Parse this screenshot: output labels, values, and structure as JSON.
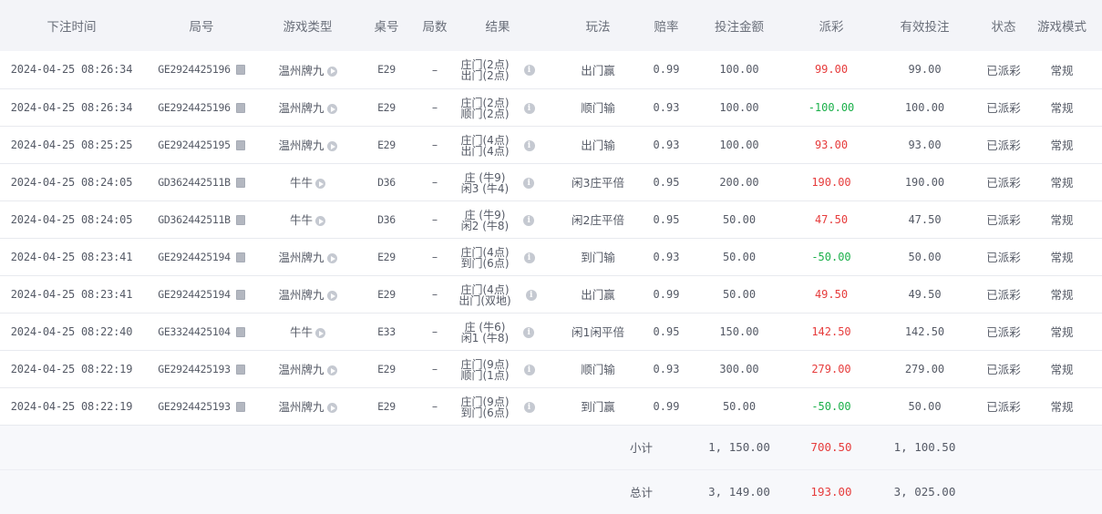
{
  "columns": [
    "下注时间",
    "局号",
    "游戏类型",
    "桌号",
    "局数",
    "结果",
    "玩法",
    "赔率",
    "投注金额",
    "派彩",
    "有效投注",
    "状态",
    "游戏模式"
  ],
  "rows": [
    {
      "time": "2024-04-25 08:26:34",
      "round": "GE2924425196",
      "game": "温州牌九",
      "table": "E29",
      "count": "–",
      "result1": "庄门(2点)",
      "result2": "出门(2点)",
      "play": "出门赢",
      "odds": "0.99",
      "bet": "100.00",
      "payout": "99.00",
      "payout_sign": "pos",
      "valid": "99.00",
      "status": "已派彩",
      "mode": "常规"
    },
    {
      "time": "2024-04-25 08:26:34",
      "round": "GE2924425196",
      "game": "温州牌九",
      "table": "E29",
      "count": "–",
      "result1": "庄门(2点)",
      "result2": "顺门(2点)",
      "play": "顺门输",
      "odds": "0.93",
      "bet": "100.00",
      "payout": "-100.00",
      "payout_sign": "neg",
      "valid": "100.00",
      "status": "已派彩",
      "mode": "常规"
    },
    {
      "time": "2024-04-25 08:25:25",
      "round": "GE2924425195",
      "game": "温州牌九",
      "table": "E29",
      "count": "–",
      "result1": "庄门(4点)",
      "result2": "出门(4点)",
      "play": "出门输",
      "odds": "0.93",
      "bet": "100.00",
      "payout": "93.00",
      "payout_sign": "pos",
      "valid": "93.00",
      "status": "已派彩",
      "mode": "常规"
    },
    {
      "time": "2024-04-25 08:24:05",
      "round": "GD362442511B",
      "game": "牛牛",
      "table": "D36",
      "count": "–",
      "result1": "庄 (牛9)",
      "result2": "闲3 (牛4)",
      "play": "闲3庄平倍",
      "odds": "0.95",
      "bet": "200.00",
      "payout": "190.00",
      "payout_sign": "pos",
      "valid": "190.00",
      "status": "已派彩",
      "mode": "常规"
    },
    {
      "time": "2024-04-25 08:24:05",
      "round": "GD362442511B",
      "game": "牛牛",
      "table": "D36",
      "count": "–",
      "result1": "庄 (牛9)",
      "result2": "闲2 (牛8)",
      "play": "闲2庄平倍",
      "odds": "0.95",
      "bet": "50.00",
      "payout": "47.50",
      "payout_sign": "pos",
      "valid": "47.50",
      "status": "已派彩",
      "mode": "常规"
    },
    {
      "time": "2024-04-25 08:23:41",
      "round": "GE2924425194",
      "game": "温州牌九",
      "table": "E29",
      "count": "–",
      "result1": "庄门(4点)",
      "result2": "到门(6点)",
      "play": "到门输",
      "odds": "0.93",
      "bet": "50.00",
      "payout": "-50.00",
      "payout_sign": "neg",
      "valid": "50.00",
      "status": "已派彩",
      "mode": "常规"
    },
    {
      "time": "2024-04-25 08:23:41",
      "round": "GE2924425194",
      "game": "温州牌九",
      "table": "E29",
      "count": "–",
      "result1": "庄门(4点)",
      "result2": "出门(双地)",
      "play": "出门赢",
      "odds": "0.99",
      "bet": "50.00",
      "payout": "49.50",
      "payout_sign": "pos",
      "valid": "49.50",
      "status": "已派彩",
      "mode": "常规"
    },
    {
      "time": "2024-04-25 08:22:40",
      "round": "GE3324425104",
      "game": "牛牛",
      "table": "E33",
      "count": "–",
      "result1": "庄 (牛6)",
      "result2": "闲1 (牛8)",
      "play": "闲1闲平倍",
      "odds": "0.95",
      "bet": "150.00",
      "payout": "142.50",
      "payout_sign": "pos",
      "valid": "142.50",
      "status": "已派彩",
      "mode": "常规"
    },
    {
      "time": "2024-04-25 08:22:19",
      "round": "GE2924425193",
      "game": "温州牌九",
      "table": "E29",
      "count": "–",
      "result1": "庄门(9点)",
      "result2": "顺门(1点)",
      "play": "顺门输",
      "odds": "0.93",
      "bet": "300.00",
      "payout": "279.00",
      "payout_sign": "pos",
      "valid": "279.00",
      "status": "已派彩",
      "mode": "常规"
    },
    {
      "time": "2024-04-25 08:22:19",
      "round": "GE2924425193",
      "game": "温州牌九",
      "table": "E29",
      "count": "–",
      "result1": "庄门(9点)",
      "result2": "到门(6点)",
      "play": "到门赢",
      "odds": "0.99",
      "bet": "50.00",
      "payout": "-50.00",
      "payout_sign": "neg",
      "valid": "50.00",
      "status": "已派彩",
      "mode": "常规"
    }
  ],
  "subtotal": {
    "label": "小计",
    "bet": "1, 150.00",
    "payout": "700.50",
    "valid": "1, 100.50"
  },
  "total": {
    "label": "总计",
    "bet": "3, 149.00",
    "payout": "193.00",
    "valid": "3, 025.00"
  },
  "colors": {
    "positive": "#e63c3c",
    "negative": "#1bb04a",
    "header_bg": "#f3f4f8",
    "summary_bg": "#f7f8fb"
  }
}
